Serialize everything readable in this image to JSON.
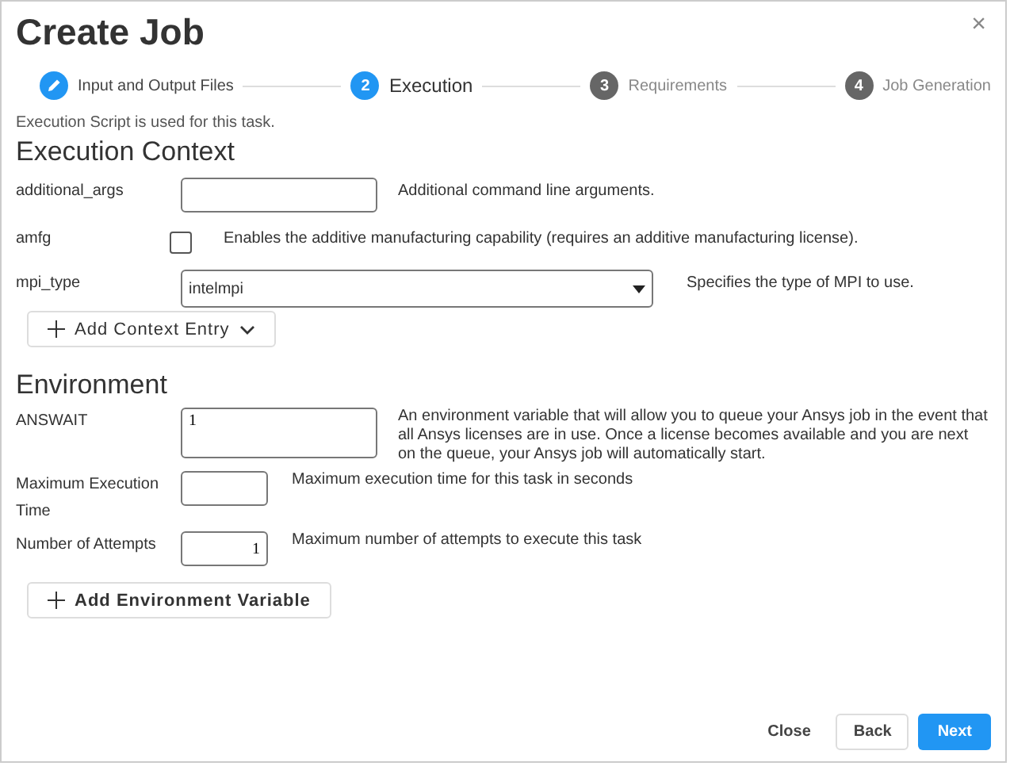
{
  "window": {
    "title": "Create Job",
    "close": "×"
  },
  "steps": [
    {
      "label": "Input and Output Files",
      "completed": true,
      "selected": false
    },
    {
      "label": "Execution",
      "completed": false,
      "selected": true,
      "number": "2"
    },
    {
      "label": "Requirements",
      "completed": false,
      "selected": false,
      "number": "3"
    },
    {
      "label": "Job Generation",
      "completed": false,
      "selected": false,
      "number": "4"
    }
  ],
  "info": "Execution Script is used for this task.",
  "context": {
    "title": "Execution Context",
    "rows": [
      {
        "kind": "text",
        "label": "additional_args",
        "value": "",
        "description": "Additional command line arguments."
      },
      {
        "kind": "checkbox",
        "label": "amfg",
        "checked": false,
        "description": "Enables the additive manufacturing capability (requires an additive manufacturing license)."
      },
      {
        "kind": "select",
        "label": "mpi_type",
        "value": "intelmpi",
        "description": "Specifies the type of MPI to use."
      }
    ],
    "add_button": "Add Context Entry"
  },
  "environment": {
    "title": "Environment",
    "rows": [
      {
        "kind": "textarea",
        "label": "ANSWAIT",
        "value": "1",
        "description": "An environment variable that will allow you to queue your Ansys job in the event that all Ansys licenses are in use. Once a license becomes available and you are next on the queue, your Ansys job will automatically start."
      },
      {
        "kind": "short",
        "label": "Maximum Execution Time",
        "value": "",
        "description": "Maximum execution time for this task in seconds"
      },
      {
        "kind": "number",
        "label": "Number of Attempts",
        "value": "1",
        "description": "Maximum number of attempts to execute this task"
      }
    ],
    "add_button": "Add Environment Variable"
  },
  "footer": {
    "close": "Close",
    "back": "Back",
    "next": "Next"
  }
}
